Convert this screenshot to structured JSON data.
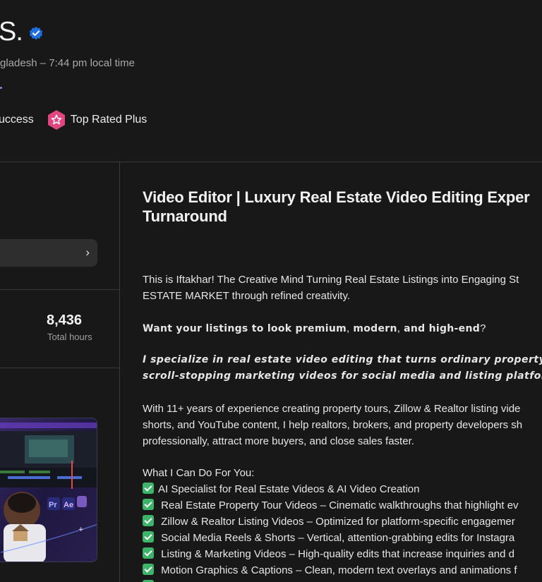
{
  "profile": {
    "name_fragment": "S.",
    "location_time": "gladesh – 7:44 pm local time",
    "badges": {
      "job_success": "uccess",
      "top_rated": "Top Rated Plus"
    }
  },
  "sidebar": {
    "total_hours_value": "8,436",
    "total_hours_label": "Total hours",
    "button_chevron": "›"
  },
  "main": {
    "title_line1": "Video Editor | Luxury Real Estate Video Editing Exper",
    "title_line2": "Turnaround",
    "intro_line1": "This is Iftakhar! The Creative Mind Turning Real Estate Listings into Engaging St",
    "intro_line2": "ESTATE MARKET through refined creativity.",
    "question_prefix": "Want your listings to look premium",
    "question_c1": ",",
    "question_mid": " modern",
    "question_c2": ",",
    "question_end": " and high-end",
    "question_mark": "?",
    "specialize_line1": "I specialize in real estate video editing that turns ordinary property f",
    "specialize_line2": "scroll-stopping marketing videos for social media and listing platfor",
    "exp_line1": "With 11+ years of experience creating property tours, Zillow & Realtor listing vide",
    "exp_line2": "shorts, and YouTube content, I help realtors, brokers, and property developers sh",
    "exp_line3": "professionally, attract more buyers, and close sales faster.",
    "services_heading": "What I Can Do For You:",
    "services": [
      "AI Specialist for Real Estate Videos & AI Video Creation",
      " Real Estate Property Tour Videos – Cinematic walkthroughs that highlight ev",
      " Zillow & Realtor Listing Videos – Optimized for platform-specific engagemer",
      " Social Media Reels & Shorts – Vertical, attention-grabbing edits for Instagra",
      " Listing & Marketing Videos – High-quality edits that increase inquiries and d",
      " Motion Graphics & Captions – Clean, modern text overlays and animations f"
    ]
  },
  "thumbnail": {
    "app_badges": [
      "Pr",
      "Ae"
    ]
  },
  "colors": {
    "background": "#181818",
    "verified_blue": "#1f6fe0",
    "top_rated_pink": "#e0477f",
    "check_green": "#3eb36a"
  }
}
